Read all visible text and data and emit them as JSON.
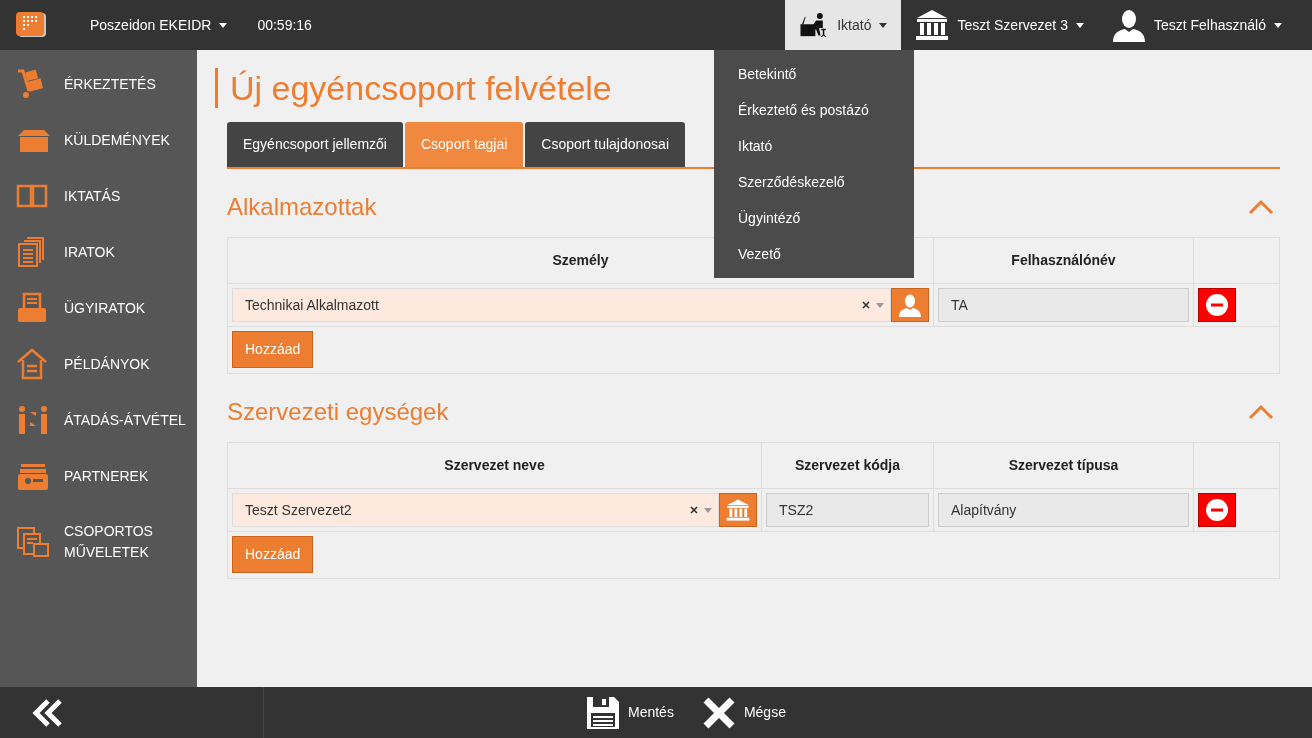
{
  "top_bar": {
    "app_menu": {
      "label": "Poszeidon EKEIDR"
    },
    "timer": "00:59:16",
    "role_menu": {
      "label": "Iktató",
      "expanded": true
    },
    "org_menu": {
      "label": "Teszt Szervezet 3"
    },
    "user_menu": {
      "label": "Teszt Felhasználó"
    }
  },
  "role_dropdown": [
    {
      "label": "Betekintő"
    },
    {
      "label": "Érkeztető és postázó"
    },
    {
      "label": "Iktató"
    },
    {
      "label": "Szerződéskezelő"
    },
    {
      "label": "Ügyintéző"
    },
    {
      "label": "Vezető"
    }
  ],
  "sidebar": {
    "items": [
      {
        "label": "ÉRKEZTETÉS"
      },
      {
        "label": "KÜLDEMÉNYEK"
      },
      {
        "label": "IKTATÁS"
      },
      {
        "label": "IRATOK"
      },
      {
        "label": "ÜGYIRATOK"
      },
      {
        "label": "PÉLDÁNYOK"
      },
      {
        "label": "ÁTADÁS-ÁTVÉTEL"
      },
      {
        "label": "PARTNEREK"
      },
      {
        "label": "CSOPORTOS MŰVELETEK"
      }
    ]
  },
  "page_title": "Új egyéncsoport felvétele",
  "tabs": [
    {
      "label": "Egyéncsoport jellemzői",
      "selected": false
    },
    {
      "label": "Csoport tagjai",
      "selected": true
    },
    {
      "label": "Csoport tulajdonosai",
      "selected": false
    }
  ],
  "sections": [
    {
      "title": "Alkalmazottak",
      "expanded": true,
      "kind": "person",
      "columns": [
        "Személy",
        "Felhasználónév"
      ],
      "rows": [
        {
          "select": "Technikai Alkalmazott",
          "fields": [
            "TA"
          ]
        }
      ],
      "add_button": "Hozzáad"
    },
    {
      "title": "Szervezeti egységek",
      "expanded": true,
      "kind": "organization",
      "columns": [
        "Szervezet neve",
        "Szervezet kódja",
        "Szervezet típusa"
      ],
      "rows": [
        {
          "select": "Teszt Szervezet2",
          "fields": [
            "TSZ2",
            "Alapítvány"
          ]
        }
      ],
      "add_button": "Hozzáad"
    }
  ],
  "bottom_bar": {
    "save": "Mentés",
    "cancel": "Mégse"
  }
}
